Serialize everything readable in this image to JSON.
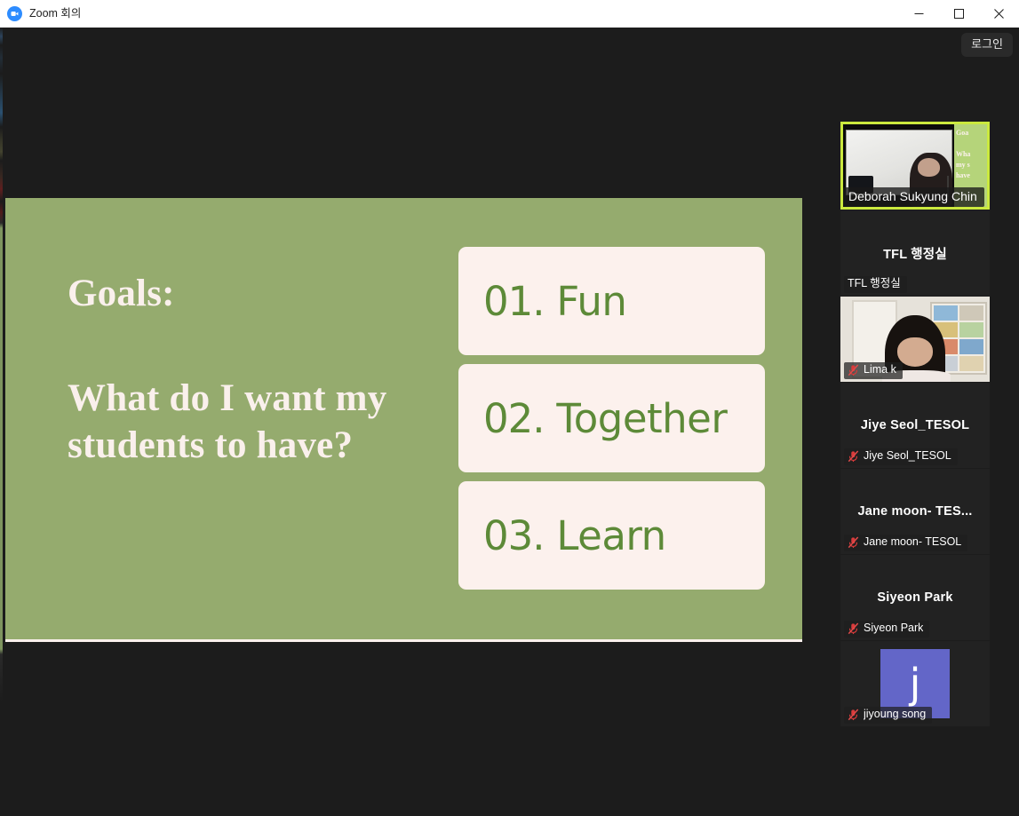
{
  "window": {
    "title": "Zoom 회의",
    "logo_text": "zm",
    "logo_name": "zoom-logo-icon",
    "controls": {
      "minimize": "minimize-icon",
      "maximize": "maximize-icon",
      "close": "close-icon"
    }
  },
  "toolbar": {
    "login_label": "로그인"
  },
  "slide": {
    "heading": "Goals:",
    "question": "What do I want my students to have?",
    "bg_color": "#95ab6e",
    "text_color": "#faf0ec",
    "card_bg_color": "#fcf1ed",
    "card_text_color": "#5d8a38",
    "goals": [
      {
        "number": "01.",
        "label": "Fun"
      },
      {
        "number": "02.",
        "label": "Together"
      },
      {
        "number": "03.",
        "label": "Learn"
      }
    ]
  },
  "participants": [
    {
      "name": "Deborah Sukyung Chin",
      "video": true,
      "muted": false,
      "active_speaker": true,
      "avatar_letter": "",
      "screen_text_1": "Goa",
      "screen_text_2": "Wha\nmy s\nhave"
    },
    {
      "name": "TFL 행정실",
      "video": false,
      "muted": false,
      "active_speaker": false,
      "avatar_letter": ""
    },
    {
      "name": "Lima k",
      "video": true,
      "muted": true,
      "active_speaker": false,
      "avatar_letter": ""
    },
    {
      "name": "Jiye Seol_TESOL",
      "video": false,
      "muted": true,
      "active_speaker": false,
      "avatar_letter": ""
    },
    {
      "name": "Jane moon- TESOL",
      "name_truncated": "Jane moon- TES...",
      "video": false,
      "muted": true,
      "active_speaker": false,
      "avatar_letter": ""
    },
    {
      "name": "Siyeon Park",
      "video": false,
      "muted": true,
      "active_speaker": false,
      "avatar_letter": ""
    },
    {
      "name": "jiyoung song",
      "video": false,
      "muted": true,
      "active_speaker": false,
      "avatar_letter": "j",
      "avatar_color": "#6366c8"
    }
  ],
  "colors": {
    "app_bg": "#1c1c1c",
    "titlebar_bg": "#ffffff",
    "active_speaker_border": "#cbe93e",
    "tile_bg": "#222222"
  }
}
